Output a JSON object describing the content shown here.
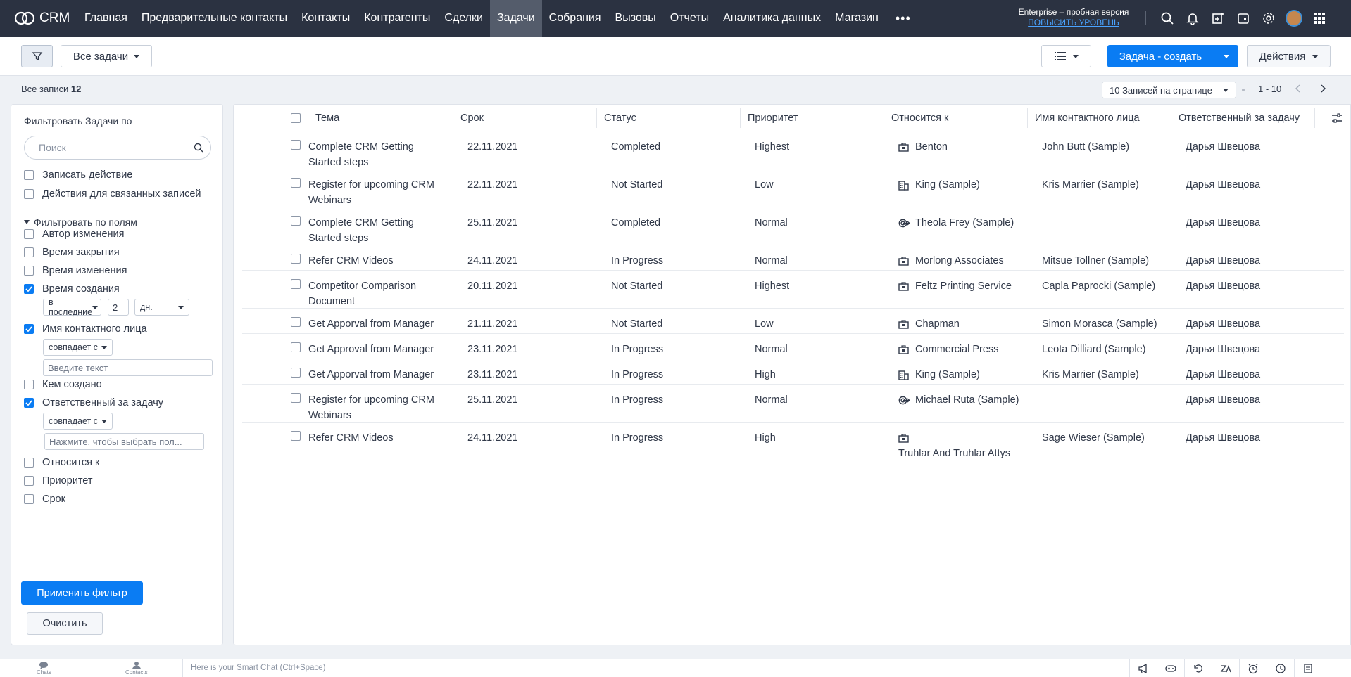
{
  "app": {
    "name": "CRM"
  },
  "nav": {
    "items": [
      {
        "label": "Главная",
        "active": false
      },
      {
        "label": "Предварительные контакты",
        "active": false
      },
      {
        "label": "Контакты",
        "active": false
      },
      {
        "label": "Контрагенты",
        "active": false
      },
      {
        "label": "Сделки",
        "active": false
      },
      {
        "label": "Задачи",
        "active": true
      },
      {
        "label": "Собрания",
        "active": false
      },
      {
        "label": "Вызовы",
        "active": false
      },
      {
        "label": "Отчеты",
        "active": false
      },
      {
        "label": "Аналитика данных",
        "active": false
      },
      {
        "label": "Магазин",
        "active": false
      }
    ],
    "more": "•••",
    "plan_line1": "Enterprise – пробная версия",
    "plan_line2": "ПОВЫСИТЬ УРОВЕНЬ",
    "icons": [
      "search-icon",
      "bell-icon",
      "new-record-icon",
      "calendar-icon",
      "gear-icon",
      "avatar",
      "apps-grid-icon"
    ]
  },
  "toolbar": {
    "view_label": "Все задачи",
    "create_label": "Задача - создать",
    "actions_label": "Действия"
  },
  "records": {
    "all_label": "Все записи",
    "count": "12",
    "per_page": "10 Записей на странице",
    "range": "1 - 10"
  },
  "sidebar": {
    "title": "Фильтровать Задачи по",
    "search_placeholder": "Поиск",
    "system_filters": [
      "Записать действие",
      "Действия для связанных записей"
    ],
    "section_label": "Фильтровать по полям",
    "fields": {
      "author": "Автор изменения",
      "closed": "Время закрытия",
      "modified": "Время изменения",
      "created": "Время создания",
      "created_op": "в последние",
      "created_value": "2",
      "created_unit": "дн.",
      "contact": "Имя контактного лица",
      "contact_op": "совпадает с",
      "contact_placeholder": "Введите текст",
      "created_by": "Кем создано",
      "owner": "Ответственный за задачу",
      "owner_op": "совпадает с",
      "owner_placeholder": "Нажмите, чтобы выбрать пол...",
      "related": "Относится к",
      "priority": "Приоритет",
      "due": "Срок"
    },
    "apply_label": "Применить фильтр",
    "clear_label": "Очистить"
  },
  "table": {
    "columns": [
      "Тема",
      "Срок",
      "Статус",
      "Приоритет",
      "Относится к",
      "Имя контактного лица",
      "Ответственный за задачу"
    ],
    "rows": [
      {
        "subject": "Complete CRM Getting Started steps",
        "due": "22.11.2021",
        "status": "Completed",
        "priority": "Highest",
        "related_icon": "account-icon",
        "related": "Benton",
        "contact": "John Butt (Sample)",
        "owner": "Дарья Швецова"
      },
      {
        "subject": "Register for upcoming CRM Webinars",
        "due": "22.11.2021",
        "status": "Not Started",
        "priority": "Low",
        "related_icon": "building-icon",
        "related": "King (Sample)",
        "contact": "Kris Marrier (Sample)",
        "owner": "Дарья Швецова"
      },
      {
        "subject": "Complete CRM Getting Started steps",
        "due": "25.11.2021",
        "status": "Completed",
        "priority": "Normal",
        "related_icon": "lead-icon",
        "related": "Theola Frey (Sample)",
        "contact": "",
        "owner": "Дарья Швецова"
      },
      {
        "subject": "Refer CRM Videos",
        "due": "24.11.2021",
        "status": "In Progress",
        "priority": "Normal",
        "related_icon": "account-icon",
        "related": "Morlong Associates",
        "contact": "Mitsue Tollner (Sample)",
        "owner": "Дарья Швецова"
      },
      {
        "subject": "Competitor Comparison Document",
        "due": "20.11.2021",
        "status": "Not Started",
        "priority": "Highest",
        "related_icon": "account-icon",
        "related": "Feltz Printing Service",
        "contact": "Capla Paprocki (Sample)",
        "owner": "Дарья Швецова"
      },
      {
        "subject": "Get Apporval from Manager",
        "due": "21.11.2021",
        "status": "Not Started",
        "priority": "Low",
        "related_icon": "account-icon",
        "related": "Chapman",
        "contact": "Simon Morasca (Sample)",
        "owner": "Дарья Швецова"
      },
      {
        "subject": "Get Approval from Manager",
        "due": "23.11.2021",
        "status": "In Progress",
        "priority": "Normal",
        "related_icon": "account-icon",
        "related": "Commercial Press",
        "contact": "Leota Dilliard (Sample)",
        "owner": "Дарья Швецова"
      },
      {
        "subject": "Get Apporval from Manager",
        "due": "23.11.2021",
        "status": "In Progress",
        "priority": "High",
        "related_icon": "building-icon",
        "related": "King (Sample)",
        "contact": "Kris Marrier (Sample)",
        "owner": "Дарья Швецова"
      },
      {
        "subject": "Register for upcoming CRM Webinars",
        "due": "25.11.2021",
        "status": "In Progress",
        "priority": "Normal",
        "related_icon": "lead-icon",
        "related": "Michael Ruta (Sample)",
        "contact": "",
        "owner": "Дарья Швецова"
      },
      {
        "subject": "Refer CRM Videos",
        "due": "24.11.2021",
        "status": "In Progress",
        "priority": "High",
        "related_icon": "account-icon",
        "related": "Truhlar And Truhlar Attys",
        "contact": "Sage Wieser (Sample)",
        "owner": "Дарья Швецова"
      }
    ]
  },
  "bottombar": {
    "chats": "Chats",
    "contacts": "Contacts",
    "smart_chat": "Here is your Smart Chat (Ctrl+Space)"
  },
  "colors": {
    "nav_bg": "#2b3241",
    "nav_active": "#545c6b",
    "accent": "#0a7cf3",
    "link": "#4aa3ff"
  }
}
